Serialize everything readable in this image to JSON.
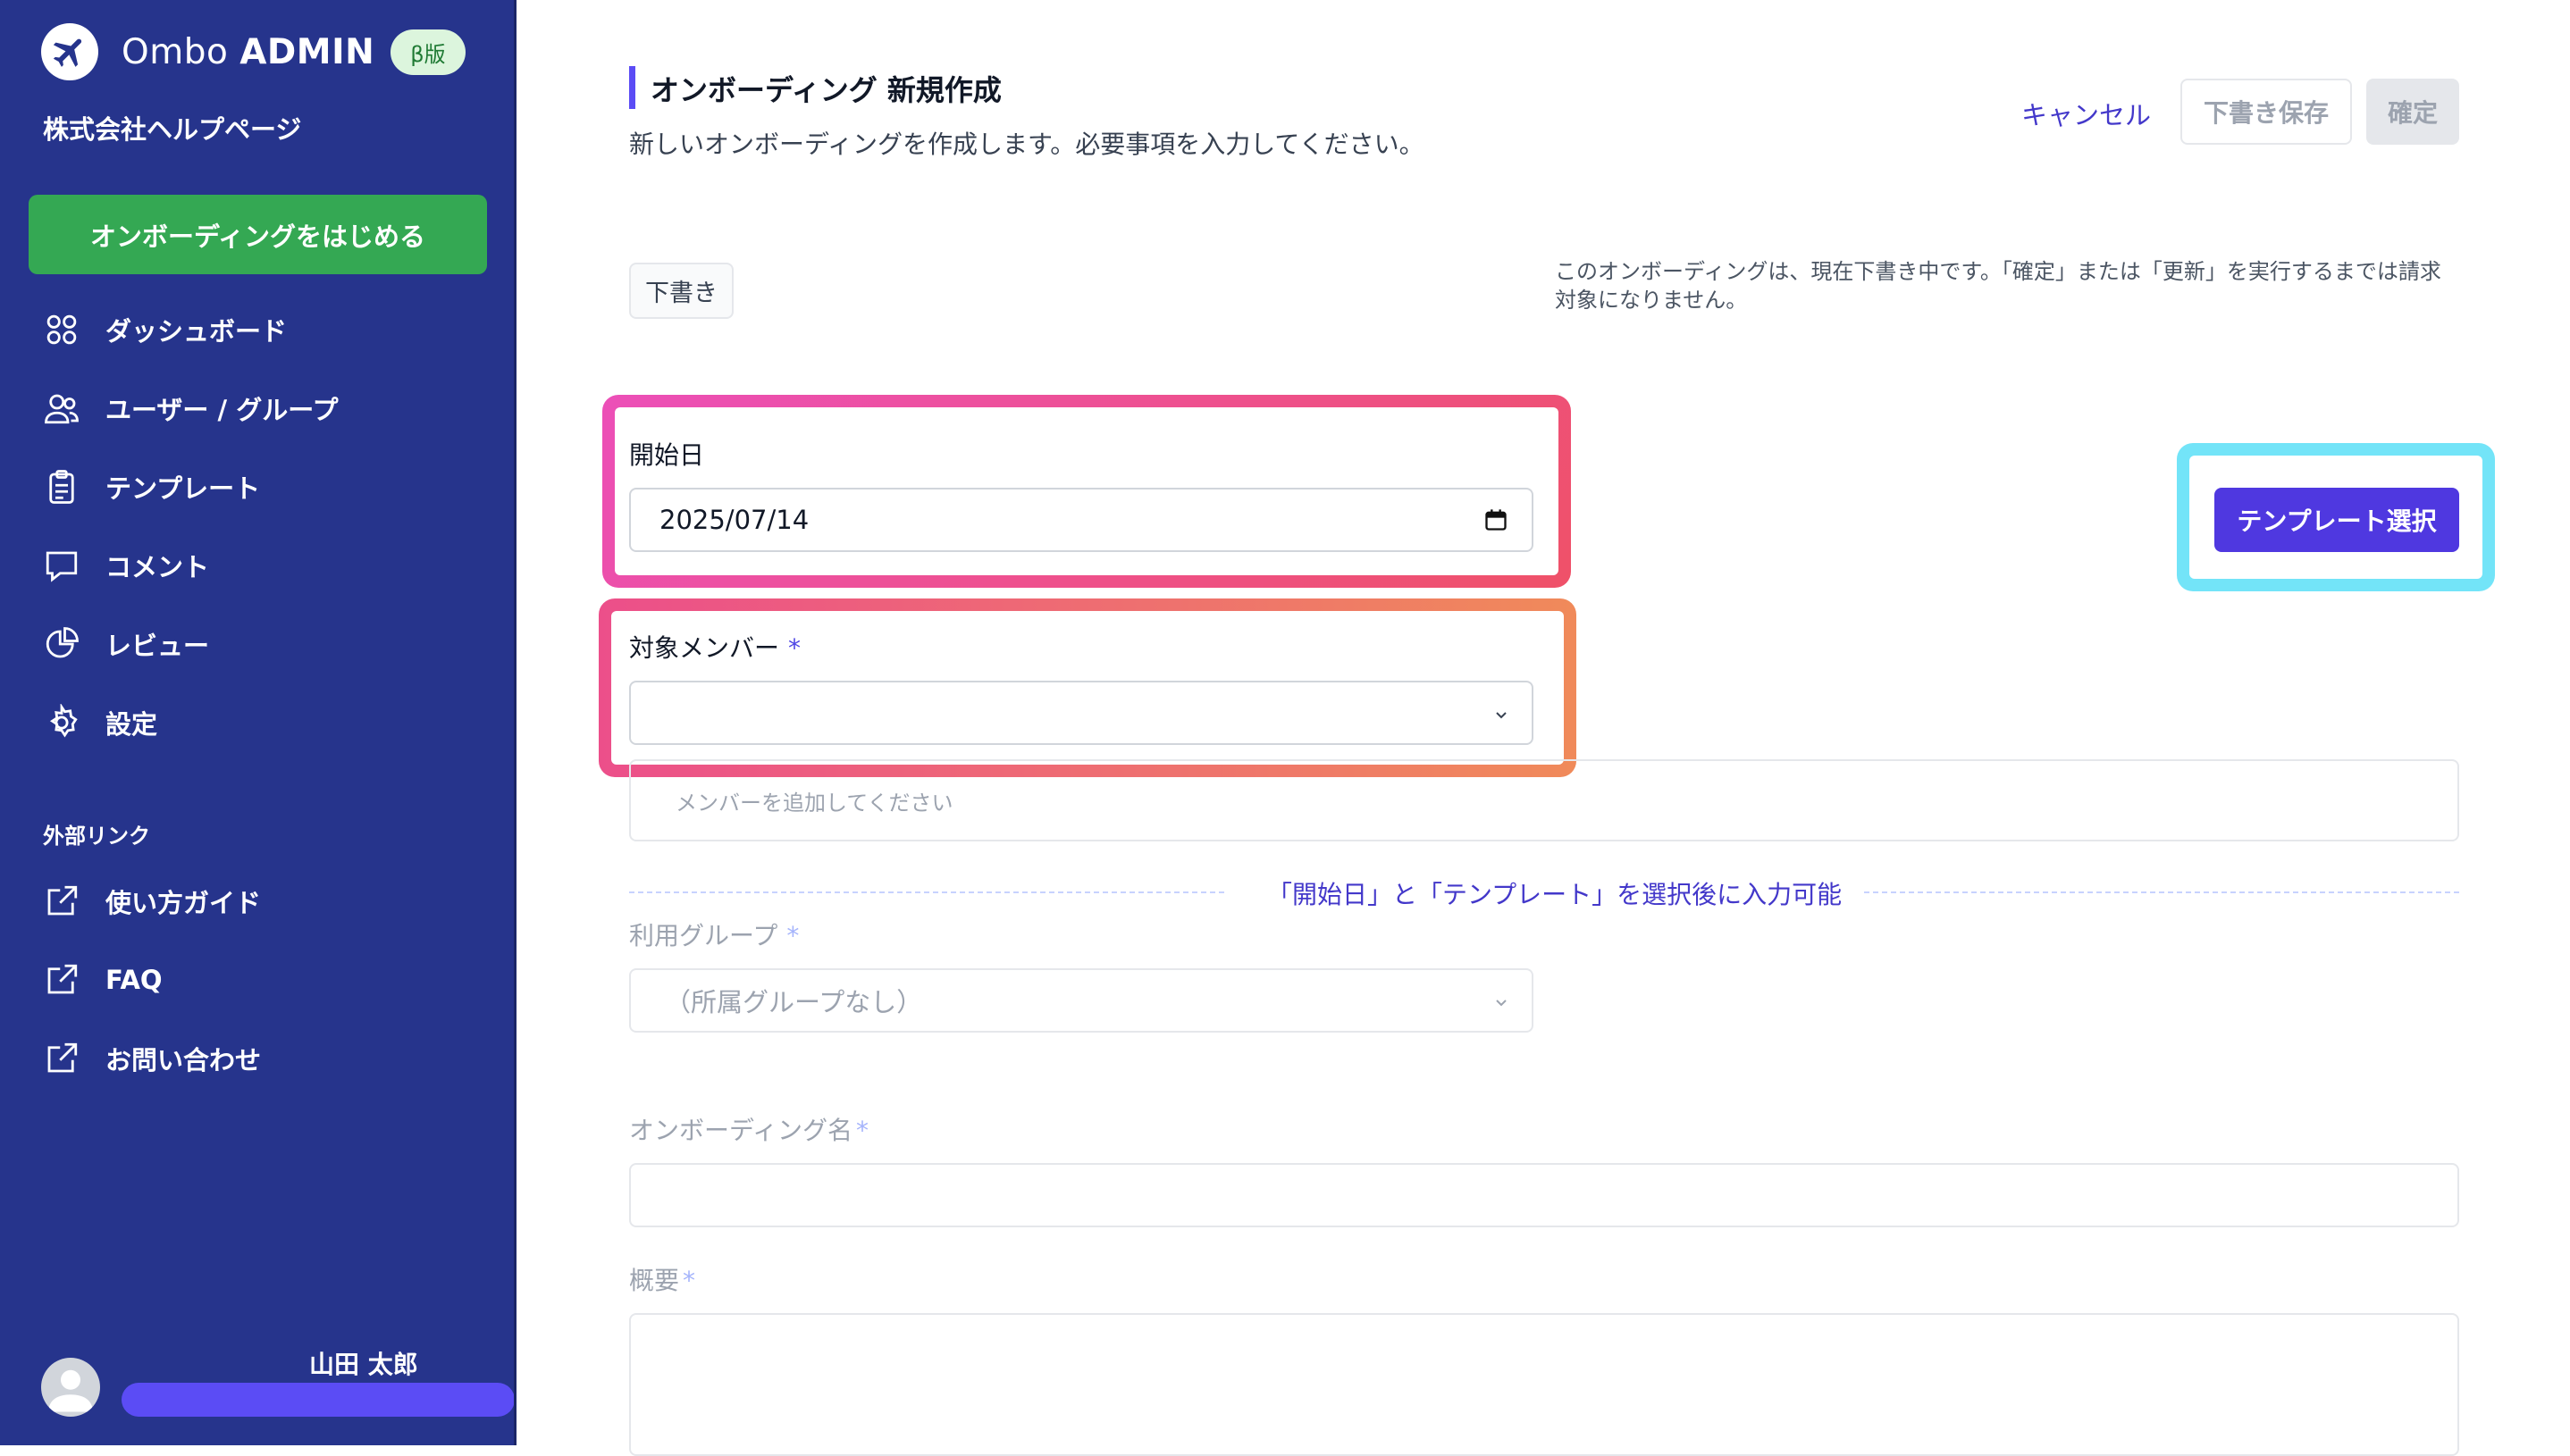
{
  "sidebar": {
    "brand_light": "Ombo",
    "brand_bold": "ADMIN",
    "beta_badge": "β版",
    "company": "株式会社ヘルプページ",
    "start_button": "オンボーディングをはじめる",
    "nav": [
      {
        "label": "ダッシュボード",
        "icon": "grid-icon"
      },
      {
        "label": "ユーザー / グループ",
        "icon": "users-icon"
      },
      {
        "label": "テンプレート",
        "icon": "clipboard-icon"
      },
      {
        "label": "コメント",
        "icon": "comment-icon"
      },
      {
        "label": "レビュー",
        "icon": "pie-chart-icon"
      },
      {
        "label": "設定",
        "icon": "gear-icon"
      }
    ],
    "external_heading": "外部リンク",
    "external": [
      {
        "label": "使い方ガイド",
        "icon": "external-link-icon"
      },
      {
        "label": "FAQ",
        "icon": "external-link-icon"
      },
      {
        "label": "お問い合わせ",
        "icon": "external-link-icon"
      }
    ],
    "user_name": "山田 太郎"
  },
  "header": {
    "title": "オンボーディング 新規作成",
    "subtitle": "新しいオンボーディングを作成します。必要事項を入力してください。",
    "cancel": "キャンセル",
    "save_draft": "下書き保存",
    "confirm": "確定"
  },
  "status": {
    "badge": "下書き",
    "notice": "このオンボーディングは、現在下書き中です。「確定」または「更新」を実行するまでは請求対象になりません。"
  },
  "form": {
    "start_date_label": "開始日",
    "start_date_value": "2025/07/14",
    "member_label": "対象メンバー",
    "required_mark": "*",
    "member_select_value": "",
    "member_placeholder": "メンバーを追加してください",
    "template_button": "テンプレート選択",
    "divider_text": "「開始日」と「テンプレート」を選択後に入力可能",
    "group_label": "利用グループ",
    "group_value": "（所属グループなし）",
    "name_label": "オンボーディング名",
    "summary_label": "概要"
  },
  "colors": {
    "sidebar_bg": "#26348c",
    "accent": "#4f38e0",
    "start_button": "#34a853"
  }
}
